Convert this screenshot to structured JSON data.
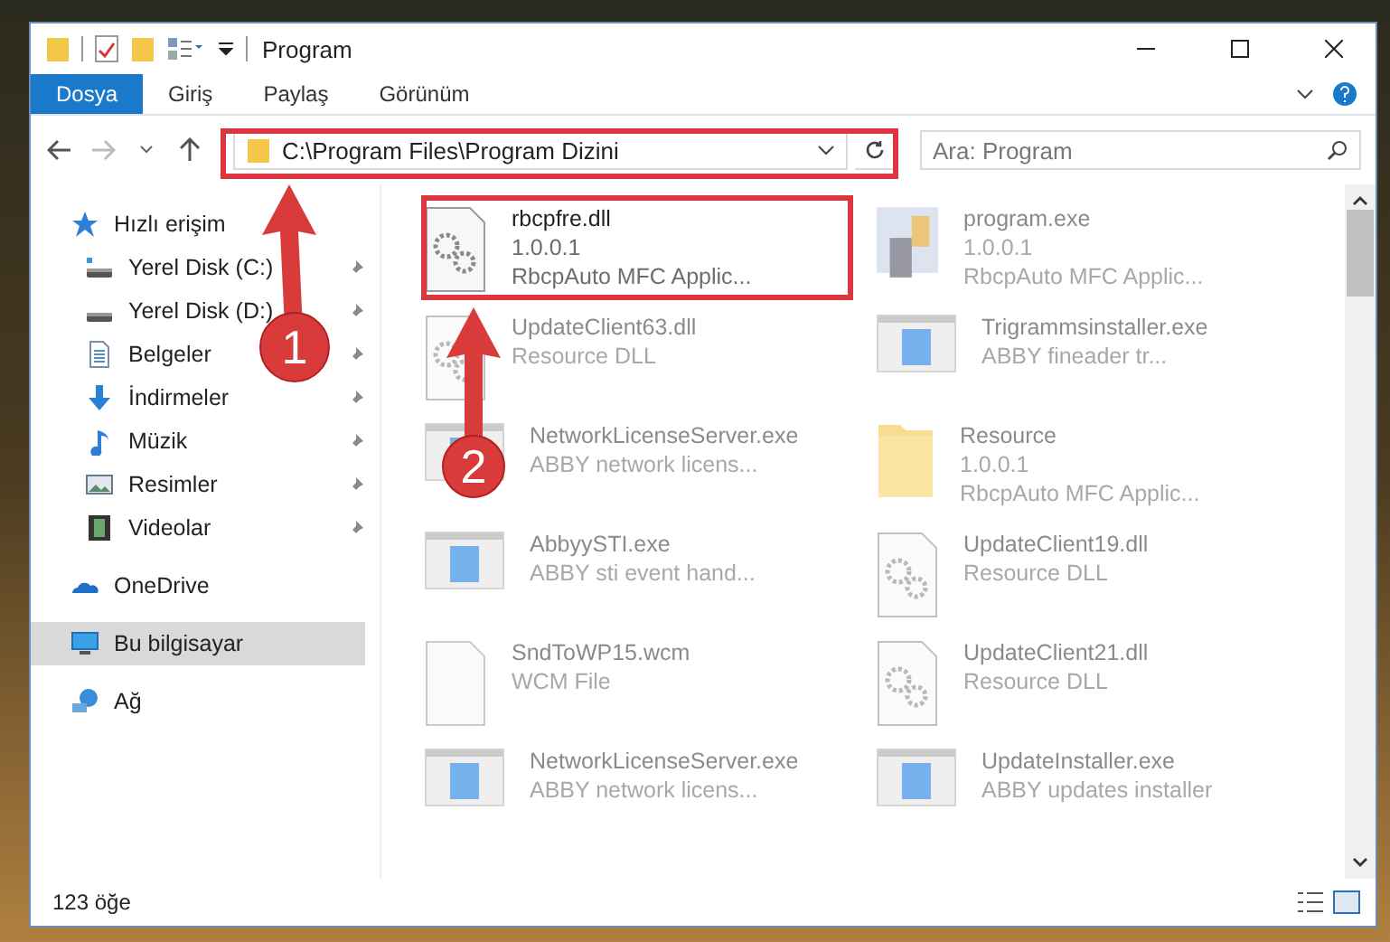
{
  "window": {
    "title": "Program"
  },
  "ribbon_tabs": [
    {
      "label": "Dosya",
      "selected": true
    },
    {
      "label": "Giriş",
      "selected": false
    },
    {
      "label": "Paylaş",
      "selected": false
    },
    {
      "label": "Görünüm",
      "selected": false
    }
  ],
  "address": {
    "path": "C:\\Program Files\\Program Dizini"
  },
  "search": {
    "placeholder": "Ara: Program"
  },
  "sidebar": {
    "items": [
      {
        "label": "Hızlı erişim",
        "kind": "star",
        "selected": false,
        "children": [
          {
            "label": "Yerel Disk (C:)",
            "kind": "system-drive",
            "pinned": true,
            "selected": false
          },
          {
            "label": "Yerel Disk (D:)",
            "kind": "drive",
            "pinned": true,
            "selected": false
          },
          {
            "label": "Belgeler",
            "kind": "document",
            "pinned": true,
            "selected": false
          },
          {
            "label": "İndirmeler",
            "kind": "download",
            "pinned": true,
            "selected": false
          },
          {
            "label": "Müzik",
            "kind": "music",
            "pinned": true,
            "selected": false
          },
          {
            "label": "Resimler",
            "kind": "picture",
            "pinned": true,
            "selected": false
          },
          {
            "label": "Videolar",
            "kind": "video",
            "pinned": true,
            "selected": false
          }
        ]
      },
      {
        "label": "OneDrive",
        "kind": "cloud",
        "selected": false
      },
      {
        "label": "Bu bilgisayar",
        "kind": "computer",
        "selected": true
      },
      {
        "label": "Ağ",
        "kind": "network",
        "selected": false
      }
    ]
  },
  "files": [
    {
      "name": "rbcpfre.dll",
      "details": [
        "1.0.0.1",
        "RbcpAuto MFC Applic..."
      ],
      "kind": "gear-file",
      "blurred": false
    },
    {
      "name": "program.exe",
      "details": [
        "1.0.0.1",
        "RbcpAuto MFC Applic..."
      ],
      "kind": "program",
      "blurred": true
    },
    {
      "name": "UpdateClient63.dll",
      "details": [
        "Resource DLL"
      ],
      "kind": "gear-file",
      "blurred": true
    },
    {
      "name": "Trigrammsinstaller.exe",
      "details": [
        "ABBY fineader tr..."
      ],
      "kind": "app",
      "blurred": true
    },
    {
      "name": "NetworkLicenseServer.exe",
      "details": [
        "ABBY network licens..."
      ],
      "kind": "app",
      "blurred": true
    },
    {
      "name": "Resource",
      "details": [
        "1.0.0.1",
        "RbcpAuto MFC Applic..."
      ],
      "kind": "folder",
      "blurred": true
    },
    {
      "name": "AbbyySTI.exe",
      "details": [
        "ABBY sti event hand..."
      ],
      "kind": "app",
      "blurred": true
    },
    {
      "name": "UpdateClient19.dll",
      "details": [
        "Resource DLL"
      ],
      "kind": "gear-file",
      "blurred": true
    },
    {
      "name": "SndToWP15.wcm",
      "details": [
        "WCM File"
      ],
      "kind": "blank",
      "blurred": true
    },
    {
      "name": "UpdateClient21.dll",
      "details": [
        "Resource DLL"
      ],
      "kind": "gear-file",
      "blurred": true
    },
    {
      "name": "NetworkLicenseServer.exe",
      "details": [
        "ABBY network licens..."
      ],
      "kind": "app",
      "blurred": true
    },
    {
      "name": "UpdateInstaller.exe",
      "details": [
        "ABBY updates installer"
      ],
      "kind": "app",
      "blurred": true
    }
  ],
  "status_bar": {
    "count": "123 öğe"
  },
  "annotations": [
    {
      "label": "1"
    },
    {
      "label": "2"
    }
  ]
}
